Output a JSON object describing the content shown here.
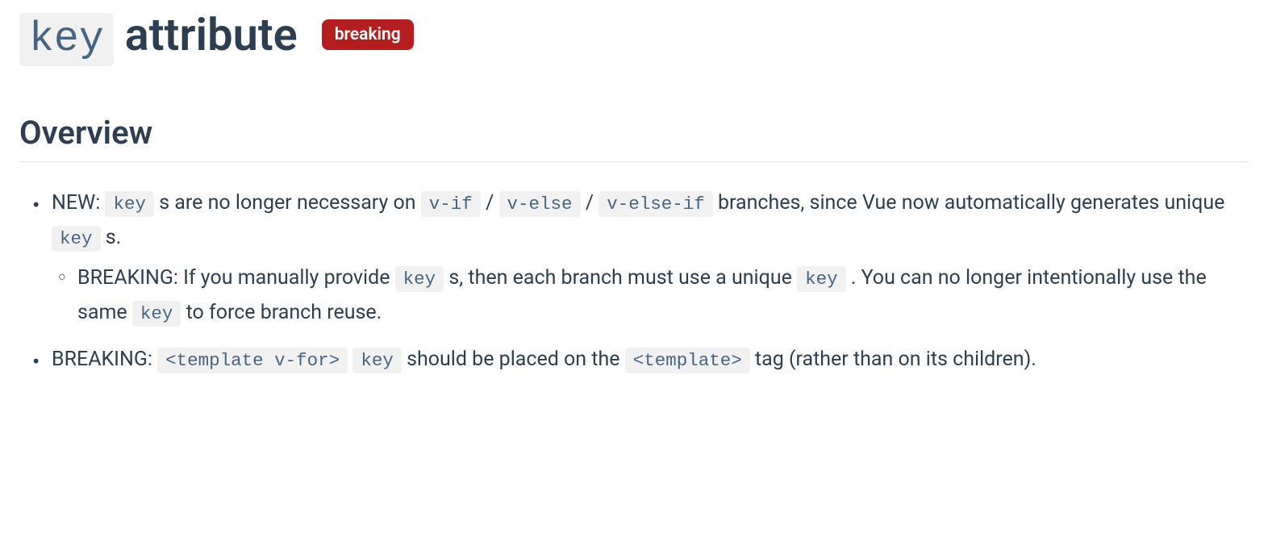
{
  "title": {
    "code": "key",
    "text": " attribute",
    "badge": "breaking"
  },
  "section_heading": "Overview",
  "bullets": {
    "item1": {
      "prefix": "NEW: ",
      "code1": "key",
      "text1": " s are no longer necessary on ",
      "code2": "v-if",
      "sep1": " / ",
      "code3": "v-else",
      "sep2": " / ",
      "code4": "v-else-if",
      "text2": " branches, since Vue now automatically generates unique ",
      "code5": "key",
      "text3": " s."
    },
    "item1_sub": {
      "prefix": "BREAKING: ",
      "text1": "If you manually provide ",
      "code1": "key",
      "text2": " s, then each branch must use a unique ",
      "code2": "key",
      "text3": " . You can no longer intentionally use the same ",
      "code3": "key",
      "text4": " to force branch reuse."
    },
    "item2": {
      "prefix": "BREAKING: ",
      "code1": "<template v-for>",
      "space1": " ",
      "code2": "key",
      "text1": " should be placed on the ",
      "code3": "<template>",
      "text2": " tag (rather than on its children)."
    }
  }
}
